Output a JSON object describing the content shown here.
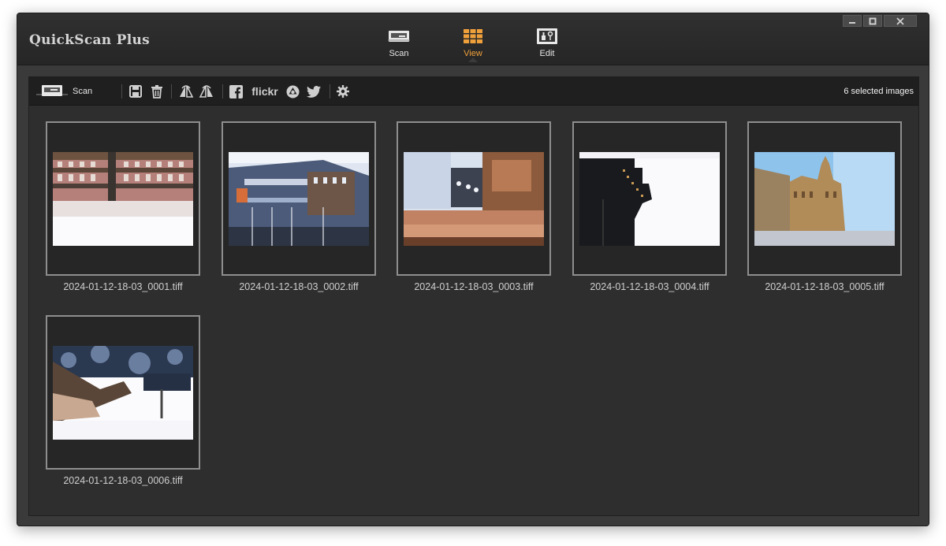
{
  "app": {
    "title": "QuickScan Plus"
  },
  "nav": {
    "items": [
      {
        "label": "Scan",
        "icon": "scanner-icon",
        "active": false
      },
      {
        "label": "View",
        "icon": "grid-view-icon",
        "active": true
      },
      {
        "label": "Edit",
        "icon": "edit-tools-icon",
        "active": false
      }
    ]
  },
  "window_controls": {
    "minimize": "minimize-icon",
    "maximize": "maximize-icon",
    "close": "close-icon"
  },
  "toolbar": {
    "scan_label": "Scan",
    "selected_count": "6 selected images",
    "flickr_label": "flickr",
    "icons": [
      "scanner-icon",
      "save-icon",
      "trash-icon",
      "flip-horizontal-icon",
      "flip-vertical-icon",
      "facebook-icon",
      "flickr-icon",
      "picasa-icon",
      "twitter-icon",
      "settings-icon"
    ]
  },
  "images": [
    {
      "filename": "2024-01-12-18-03_0001.tiff"
    },
    {
      "filename": "2024-01-12-18-03_0002.tiff"
    },
    {
      "filename": "2024-01-12-18-03_0003.tiff"
    },
    {
      "filename": "2024-01-12-18-03_0004.tiff"
    },
    {
      "filename": "2024-01-12-18-03_0005.tiff"
    },
    {
      "filename": "2024-01-12-18-03_0006.tiff"
    }
  ],
  "colors": {
    "accent": "#f0a03a",
    "window_bg": "#3a3a3a",
    "content_bg": "#2e2e2e",
    "toolbar_bg": "#1f1f1f",
    "thumb_border": "#8e8e8e"
  }
}
